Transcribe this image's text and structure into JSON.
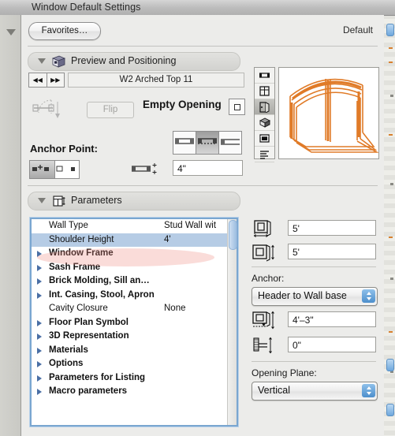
{
  "window": {
    "title": "Window Default Settings"
  },
  "toolbar": {
    "favorites_label": "Favorites…",
    "default_label": "Default"
  },
  "sections": {
    "preview": {
      "title": "Preview and Positioning",
      "icon": "cube-icon",
      "object_name": "W2 Arched Top 11",
      "prev_label": "◀◀",
      "next_label": "▶▶",
      "flip_label": "Flip",
      "empty_opening_label": "Empty Opening",
      "anchor_point_label": "Anchor Point:",
      "depth_value": "4\"",
      "preview_icons": [
        "floor-plan-icon",
        "window-grid-icon",
        "front-view-icon",
        "3d-view-icon",
        "section-icon",
        "list-icon"
      ],
      "preview_selected_index": 2
    },
    "parameters": {
      "title": "Parameters",
      "icon": "parameters-icon",
      "rows": [
        {
          "name": "Wall Type",
          "value": "Stud Wall wit",
          "expandable": false,
          "group": false,
          "selected": false
        },
        {
          "name": "Shoulder Height",
          "value": "4'",
          "expandable": false,
          "group": false,
          "selected": true
        },
        {
          "name": "Window Frame",
          "value": "",
          "expandable": true,
          "group": true,
          "selected": false
        },
        {
          "name": "Sash Frame",
          "value": "",
          "expandable": true,
          "group": true,
          "selected": false
        },
        {
          "name": "Brick Molding, Sill an…",
          "value": "",
          "expandable": true,
          "group": true,
          "selected": false
        },
        {
          "name": "Int. Casing, Stool, Apron",
          "value": "",
          "expandable": true,
          "group": true,
          "selected": false
        },
        {
          "name": "Cavity Closure",
          "value": "None",
          "expandable": false,
          "group": false,
          "selected": false
        },
        {
          "name": "Floor Plan Symbol",
          "value": "",
          "expandable": true,
          "group": true,
          "selected": false
        },
        {
          "name": "3D Representation",
          "value": "",
          "expandable": true,
          "group": true,
          "selected": false
        },
        {
          "name": "Materials",
          "value": "",
          "expandable": true,
          "group": true,
          "selected": false
        },
        {
          "name": "Options",
          "value": "",
          "expandable": true,
          "group": true,
          "selected": false
        },
        {
          "name": "Parameters for Listing",
          "value": "",
          "expandable": true,
          "group": true,
          "selected": false
        },
        {
          "name": "Macro parameters",
          "value": "",
          "expandable": true,
          "group": true,
          "selected": false
        }
      ],
      "fields": {
        "width_value": "5'",
        "height_value": "5'",
        "anchor_label": "Anchor:",
        "anchor_value": "Header to Wall base",
        "sill_value": "4'–3\"",
        "offset_value": "0\"",
        "opening_plane_label": "Opening Plane:",
        "opening_plane_value": "Vertical"
      }
    }
  },
  "colors": {
    "selection_blue": "#b6cce5",
    "focus_border": "#7aa6d0",
    "annotation_pink": "#f08c82",
    "preview_orange": "#e07b28",
    "popup_arrow_blue": "#4d8fcc"
  }
}
